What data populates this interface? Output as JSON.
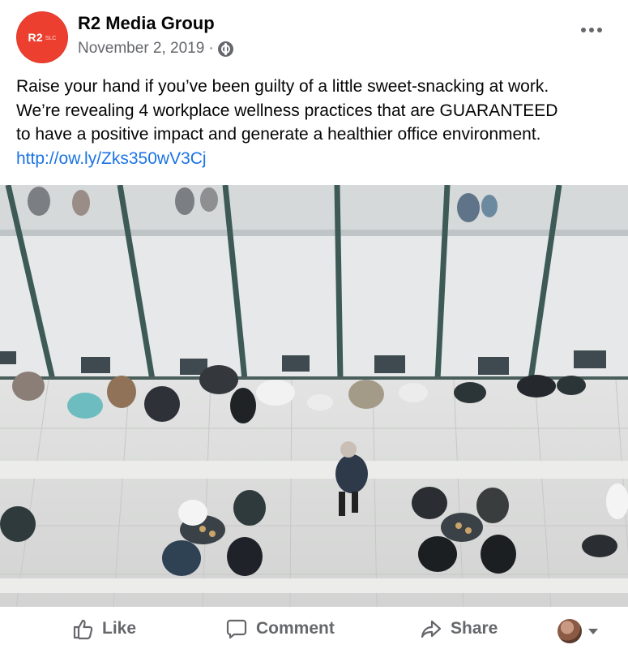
{
  "post": {
    "page_name": "R2 Media Group",
    "date": "November 2, 2019",
    "separator": "·",
    "avatar_text": "R2",
    "avatar_subtext": "SLC",
    "text_lines": [
      "Raise your hand if you’ve been guilty of a little sweet-snacking at work.",
      "We’re revealing 4 workplace wellness practices that are GUARANTEED",
      "to have a positive impact and generate a healthier office environment."
    ],
    "link": "http://ow.ly/Zks350wV3Cj"
  },
  "actions": {
    "like": "Like",
    "comment": "Comment",
    "share": "Share"
  },
  "icons": {
    "audience": "globe-icon",
    "more": "more-options-icon",
    "like": "thumbs-up-icon",
    "comment": "comment-bubble-icon",
    "share": "share-arrow-icon",
    "reaction_selector": "chevron-down-icon"
  },
  "colors": {
    "brand_avatar": "#ec3f2f",
    "link": "#1b74e4",
    "secondary_text": "#65676b"
  }
}
